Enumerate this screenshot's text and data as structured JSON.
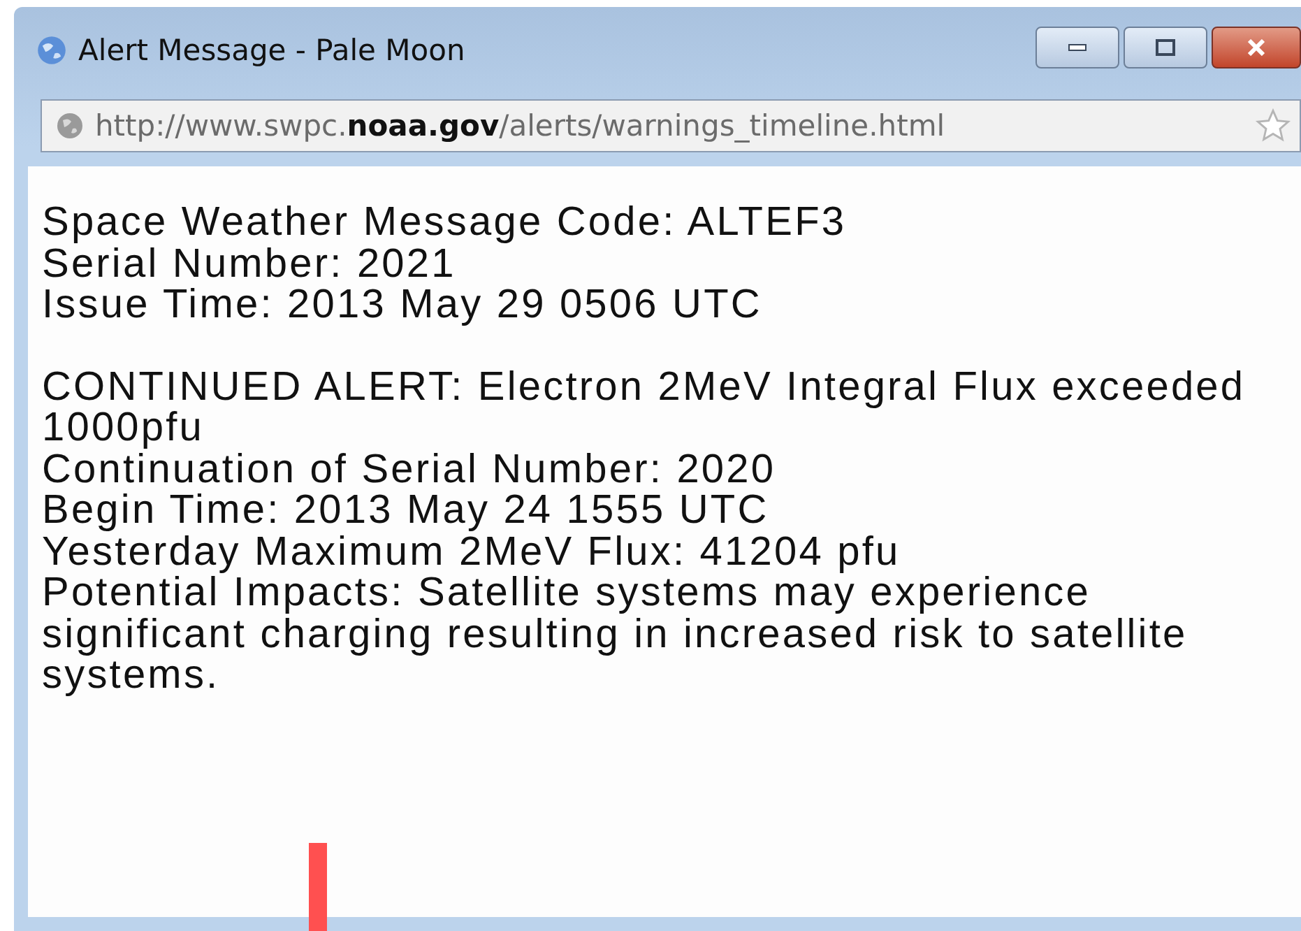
{
  "window": {
    "title": "Alert Message - Pale Moon"
  },
  "address_bar": {
    "url": "http://www.swpc.**noaa.gov**/alerts/warnings_timeline.html"
  },
  "message": {
    "header_lines": [
      "Space Weather Message Code: ALTEF3",
      "Serial Number: 2021",
      "Issue Time: 2013 May 29 0506 UTC"
    ],
    "body_lines": [
      "CONTINUED ALERT: Electron 2MeV Integral Flux exceeded 1000pfu",
      "Continuation of Serial Number: 2020",
      "Begin Time: 2013 May 24 1555 UTC",
      "Yesterday Maximum 2MeV Flux: 41204 pfu",
      "Potential Impacts: Satellite systems may experience significant charging resulting in increased risk to satellite systems."
    ]
  }
}
